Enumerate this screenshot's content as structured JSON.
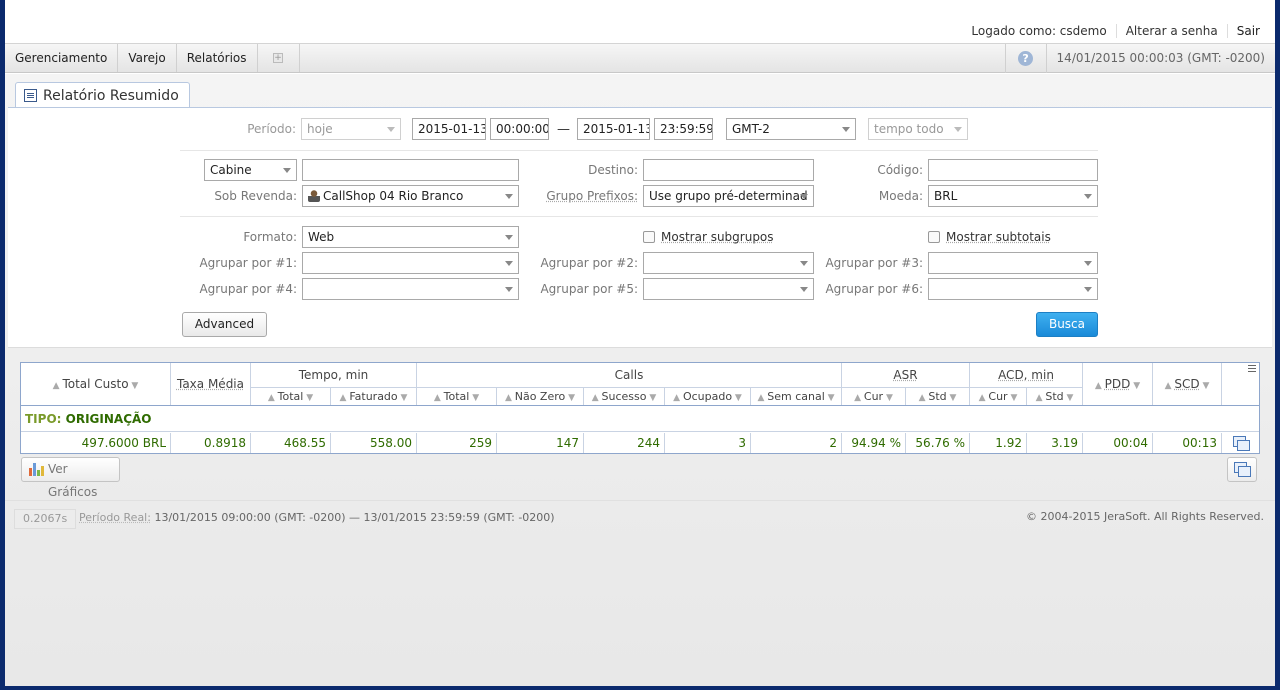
{
  "header": {
    "logged_as": "Logado como: csdemo",
    "change_password": "Alterar a senha",
    "logout": "Sair"
  },
  "menu": {
    "items": [
      "Gerenciamento",
      "Varejo",
      "Relatórios"
    ],
    "datetime": "14/01/2015 00:00:03 (GMT: -0200)"
  },
  "tab": {
    "title": "Relatório Resumido"
  },
  "form": {
    "periodo_label": "Período:",
    "periodo_value": "hoje",
    "date_from": "2015-01-13",
    "time_from": "00:00:00",
    "dash": "—",
    "date_to": "2015-01-13",
    "time_to": "23:59:59",
    "timezone": "GMT-2",
    "range": "tempo todo",
    "cabine": "Cabine",
    "cabine_input": "",
    "destino_label": "Destino:",
    "destino_value": "",
    "codigo_label": "Código:",
    "codigo_value": "",
    "sob_revenda_label": "Sob Revenda:",
    "sob_revenda_value": "CallShop 04 Rio Branco",
    "grupo_prefixos_label": "Grupo Prefixos:",
    "grupo_prefixos_value": "Use grupo pré-determinad",
    "moeda_label": "Moeda:",
    "moeda_value": "BRL",
    "formato_label": "Formato:",
    "formato_value": "Web",
    "mostrar_subgrupos": "Mostrar subgrupos",
    "mostrar_subtotais": "Mostrar subtotais",
    "agrupar1": "Agrupar por #1:",
    "agrupar2": "Agrupar por #2:",
    "agrupar3": "Agrupar por #3:",
    "agrupar4": "Agrupar por #4:",
    "agrupar5": "Agrupar por #5:",
    "agrupar6": "Agrupar por #6:",
    "advanced": "Advanced",
    "busca": "Busca"
  },
  "table": {
    "headers": {
      "total_custo": "Total Custo",
      "taxa_media": "Taxa Média",
      "tempo": "Tempo, min",
      "tempo_total": "Total",
      "tempo_faturado": "Faturado",
      "calls": "Calls",
      "calls_total": "Total",
      "calls_nao_zero": "Não Zero",
      "calls_sucesso": "Sucesso",
      "calls_ocupado": "Ocupado",
      "calls_sem_canal": "Sem canal",
      "asr": "ASR",
      "asr_cur": "Cur",
      "asr_std": "Std",
      "acd": "ACD, min",
      "acd_cur": "Cur",
      "acd_std": "Std",
      "pdd": "PDD",
      "scd": "SCD"
    },
    "group_key": "TIPO:",
    "group_value": "ORIGINAÇÃO",
    "row": {
      "total_custo": "497.6000 BRL",
      "taxa_media": "0.8918",
      "tempo_total": "468.55",
      "tempo_faturado": "558.00",
      "calls_total": "259",
      "calls_nao_zero": "147",
      "calls_sucesso": "244",
      "calls_ocupado": "3",
      "calls_sem_canal": "2",
      "asr_cur": "94.94 %",
      "asr_std": "56.76 %",
      "acd_cur": "1.92",
      "acd_std": "3.19",
      "pdd": "00:04",
      "scd": "00:13"
    }
  },
  "ver_graficos": "Ver Gráficos",
  "footer": {
    "timing": "0.2067s",
    "periodo_real_label": "Período Real:",
    "periodo_real_value": "13/01/2015 09:00:00 (GMT: -0200) — 13/01/2015 23:59:59 (GMT: -0200)",
    "copyright": "© 2004-2015 JeraSoft. All Rights Reserved."
  },
  "colors": {
    "accent_blue": "#1a8ad8",
    "data_green": "#2f6b00",
    "frame": "#0b2a6d"
  }
}
